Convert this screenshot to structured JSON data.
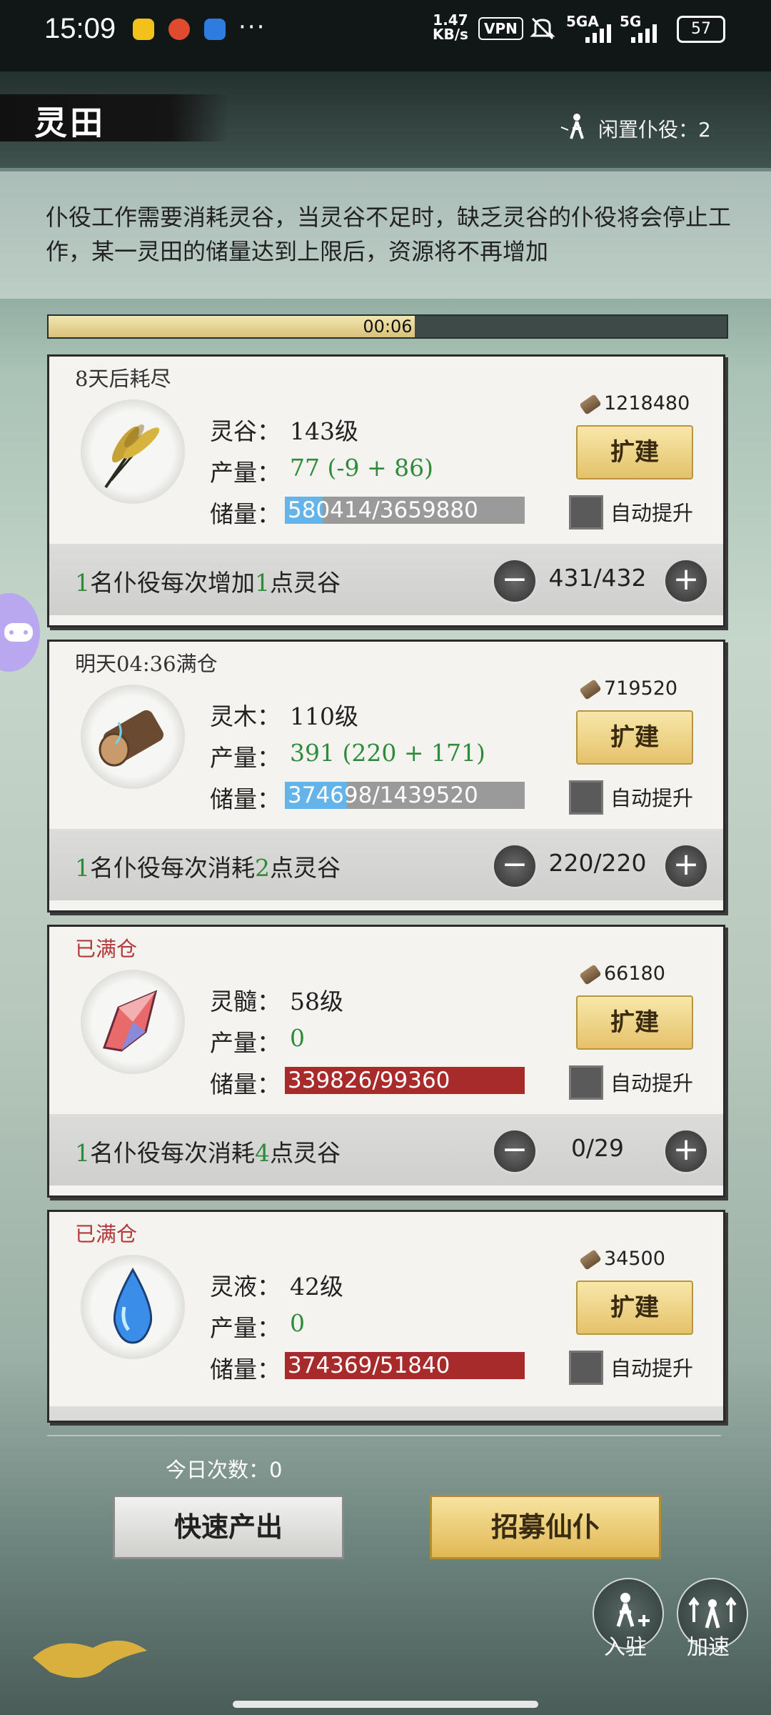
{
  "status_bar": {
    "time": "15:09",
    "net_speed_value": "1.47",
    "net_speed_unit": "KB/s",
    "vpn": "VPN",
    "signal1": "5GA",
    "signal2": "5G",
    "battery": "57",
    "more": "···"
  },
  "header": {
    "title": "灵田",
    "idle_workers": "闲置仆役：2"
  },
  "description": "仆役工作需要消耗灵谷，当灵谷不足时，缺乏灵谷的仆役将会停止工作，某一灵田的储量达到上限后，资源将不再增加",
  "timer": {
    "text": "00:06",
    "progress": 0.54
  },
  "labels": {
    "output": "产量：",
    "storage": "储量：",
    "expand": "扩建",
    "auto_upgrade": "自动提升",
    "minus": "−",
    "plus": "+"
  },
  "fields": [
    {
      "status": "8天后耗尽",
      "name_label": "灵谷：",
      "level": "143级",
      "output": "77 (-9 + 86)",
      "storage": "580414/3659880",
      "storage_ratio": 0.159,
      "cost": "1218480",
      "worker_count": "1",
      "worker_action": "名仆役每次增加",
      "worker_points": "1",
      "worker_unit": "点灵谷",
      "assigned": "431/432"
    },
    {
      "status": "明天04:36满仓",
      "name_label": "灵木：",
      "level": "110级",
      "output": "391 (220 + 171)",
      "storage": "374698/1439520",
      "storage_ratio": 0.26,
      "cost": "719520",
      "worker_count": "1",
      "worker_action": "名仆役每次消耗",
      "worker_points": "2",
      "worker_unit": "点灵谷",
      "assigned": "220/220"
    },
    {
      "status": "已满仓",
      "name_label": "灵髓：",
      "level": "58级",
      "output": "0",
      "storage": "339826/99360",
      "storage_ratio": 1,
      "cost": "66180",
      "worker_count": "1",
      "worker_action": "名仆役每次消耗",
      "worker_points": "4",
      "worker_unit": "点灵谷",
      "assigned": "0/29"
    },
    {
      "status": "已满仓",
      "name_label": "灵液：",
      "level": "42级",
      "output": "0",
      "storage": "374369/51840",
      "storage_ratio": 1,
      "cost": "34500"
    }
  ],
  "bottom": {
    "today_count": "今日次数：0",
    "quick_produce": "快速产出",
    "recruit": "招募仙仆",
    "station": "入驻",
    "speedup": "加速"
  },
  "colors": {
    "green": "#2e8b3a",
    "full_red": "#a82b2b",
    "storage_blue": "#64b4ea",
    "gold": "#e4c26a"
  }
}
